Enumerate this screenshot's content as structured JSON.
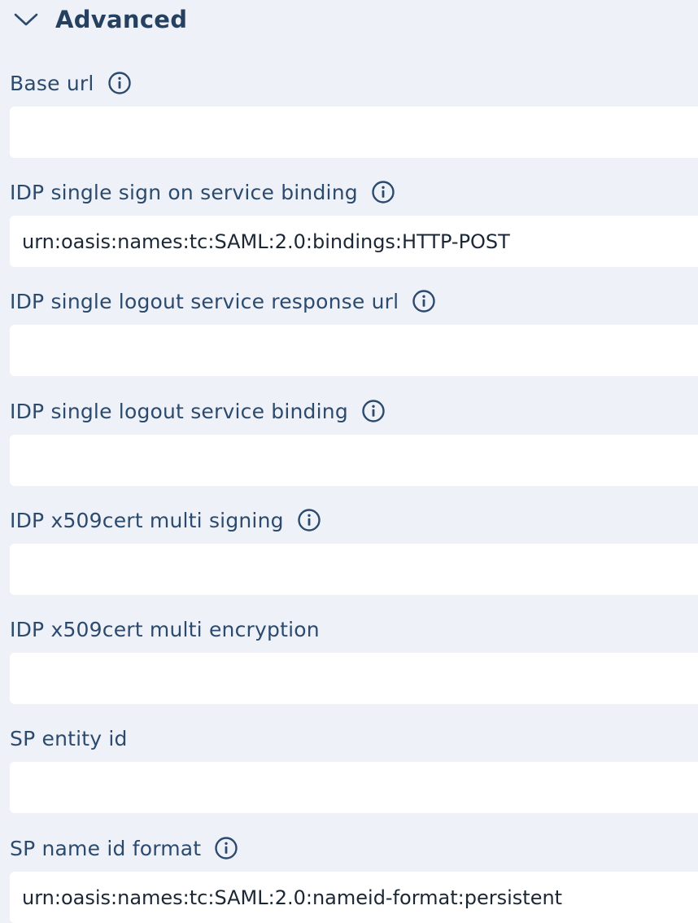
{
  "section": {
    "title": "Advanced",
    "icon": "chevron-down-icon"
  },
  "fields": [
    {
      "label": "Base url",
      "value": "",
      "has_info": true
    },
    {
      "label": "IDP single sign on service binding",
      "value": "urn:oasis:names:tc:SAML:2.0:bindings:HTTP-POST",
      "has_info": true
    },
    {
      "label": "IDP single logout service response url",
      "value": "",
      "has_info": true
    },
    {
      "label": "IDP single logout service binding",
      "value": "",
      "has_info": true
    },
    {
      "label": "IDP x509cert multi signing",
      "value": "",
      "has_info": true
    },
    {
      "label": "IDP x509cert multi encryption",
      "value": "",
      "has_info": false
    },
    {
      "label": "SP entity id",
      "value": "",
      "has_info": false
    },
    {
      "label": "SP name id format",
      "value": "urn:oasis:names:tc:SAML:2.0:nameid-format:persistent",
      "has_info": true
    }
  ],
  "colors": {
    "background": "#eef2f8",
    "label": "#2c4a6d",
    "title": "#25415f",
    "input_bg": "#ffffff"
  }
}
